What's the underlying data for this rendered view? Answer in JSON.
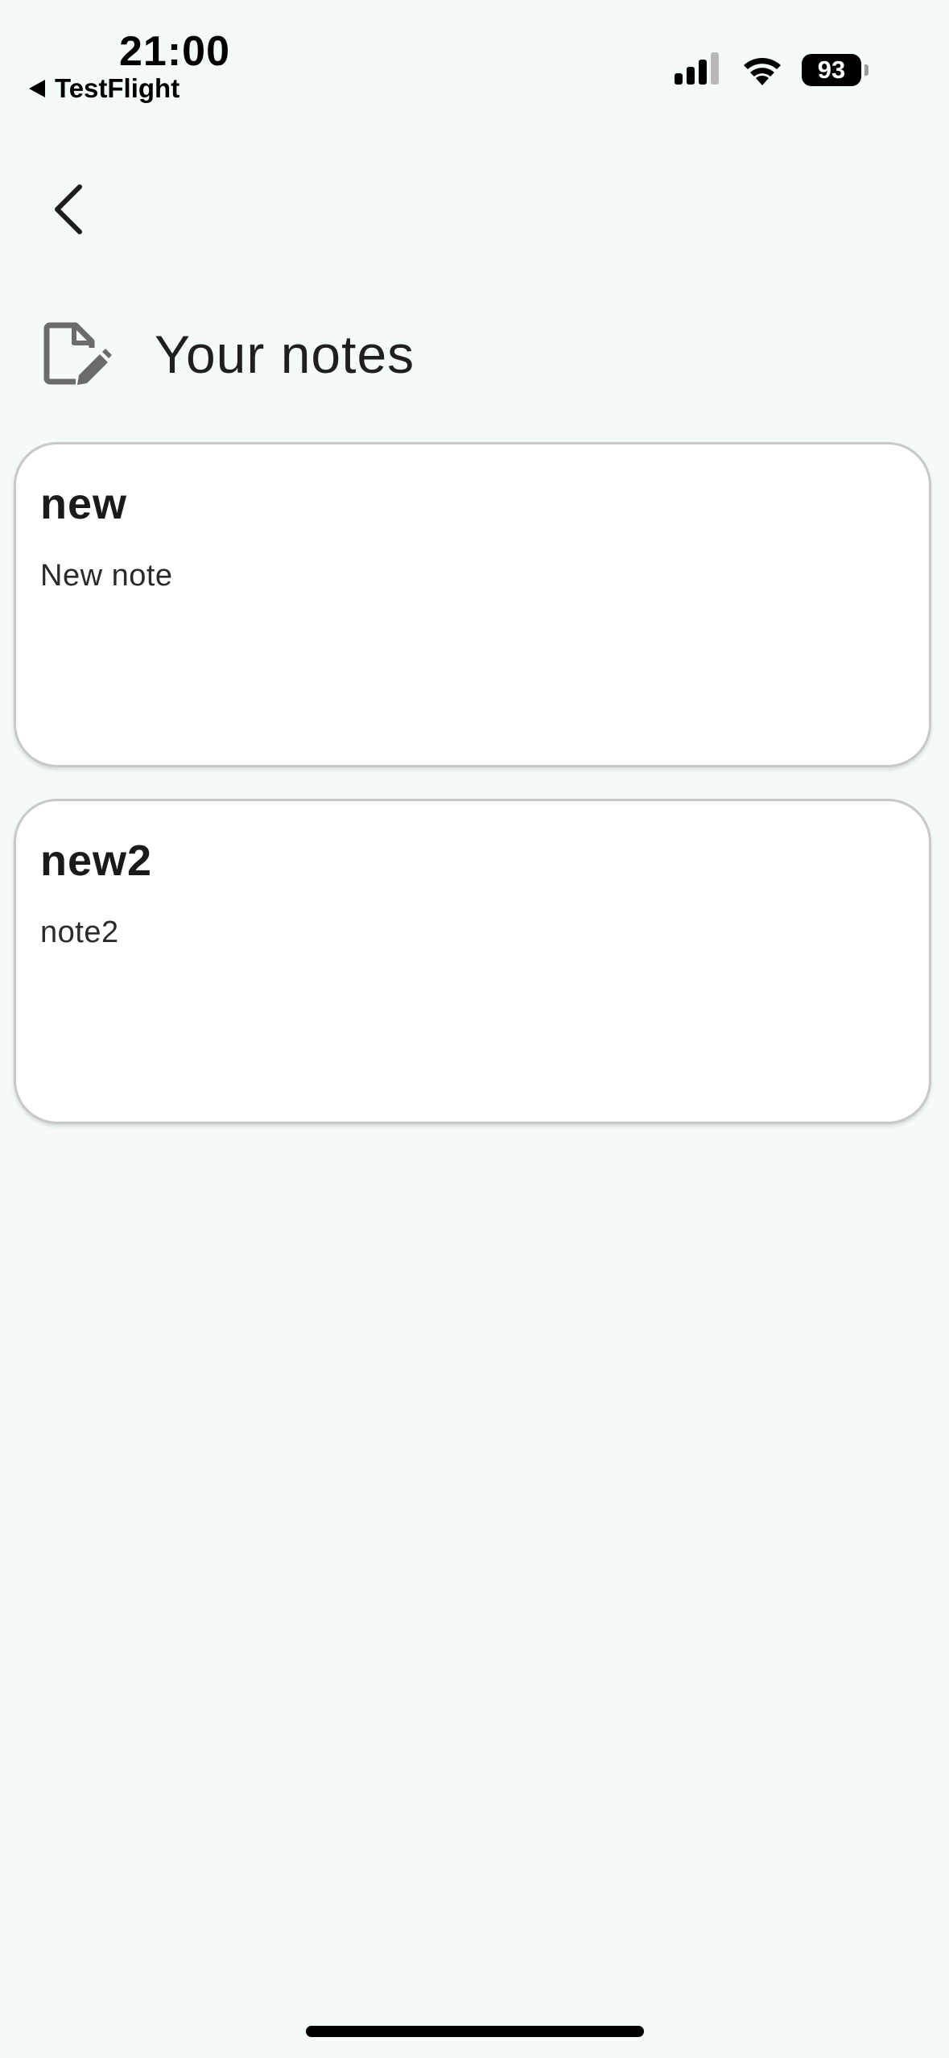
{
  "status_bar": {
    "time": "21:00",
    "back_app": "TestFlight",
    "battery_level": "93",
    "signal_icon": "cellular-signal-icon",
    "wifi_icon": "wifi-icon"
  },
  "nav": {
    "back_icon": "chevron-left-icon"
  },
  "header": {
    "icon": "note-edit-icon",
    "title": "Your notes"
  },
  "notes": [
    {
      "title": "new",
      "body": "New note"
    },
    {
      "title": "new2",
      "body": "note2"
    }
  ],
  "colors": {
    "background": "#f4f9f9",
    "card": "#ffffff",
    "card_border": "#c8c8c8",
    "icon_gray": "#6b6b6b"
  }
}
